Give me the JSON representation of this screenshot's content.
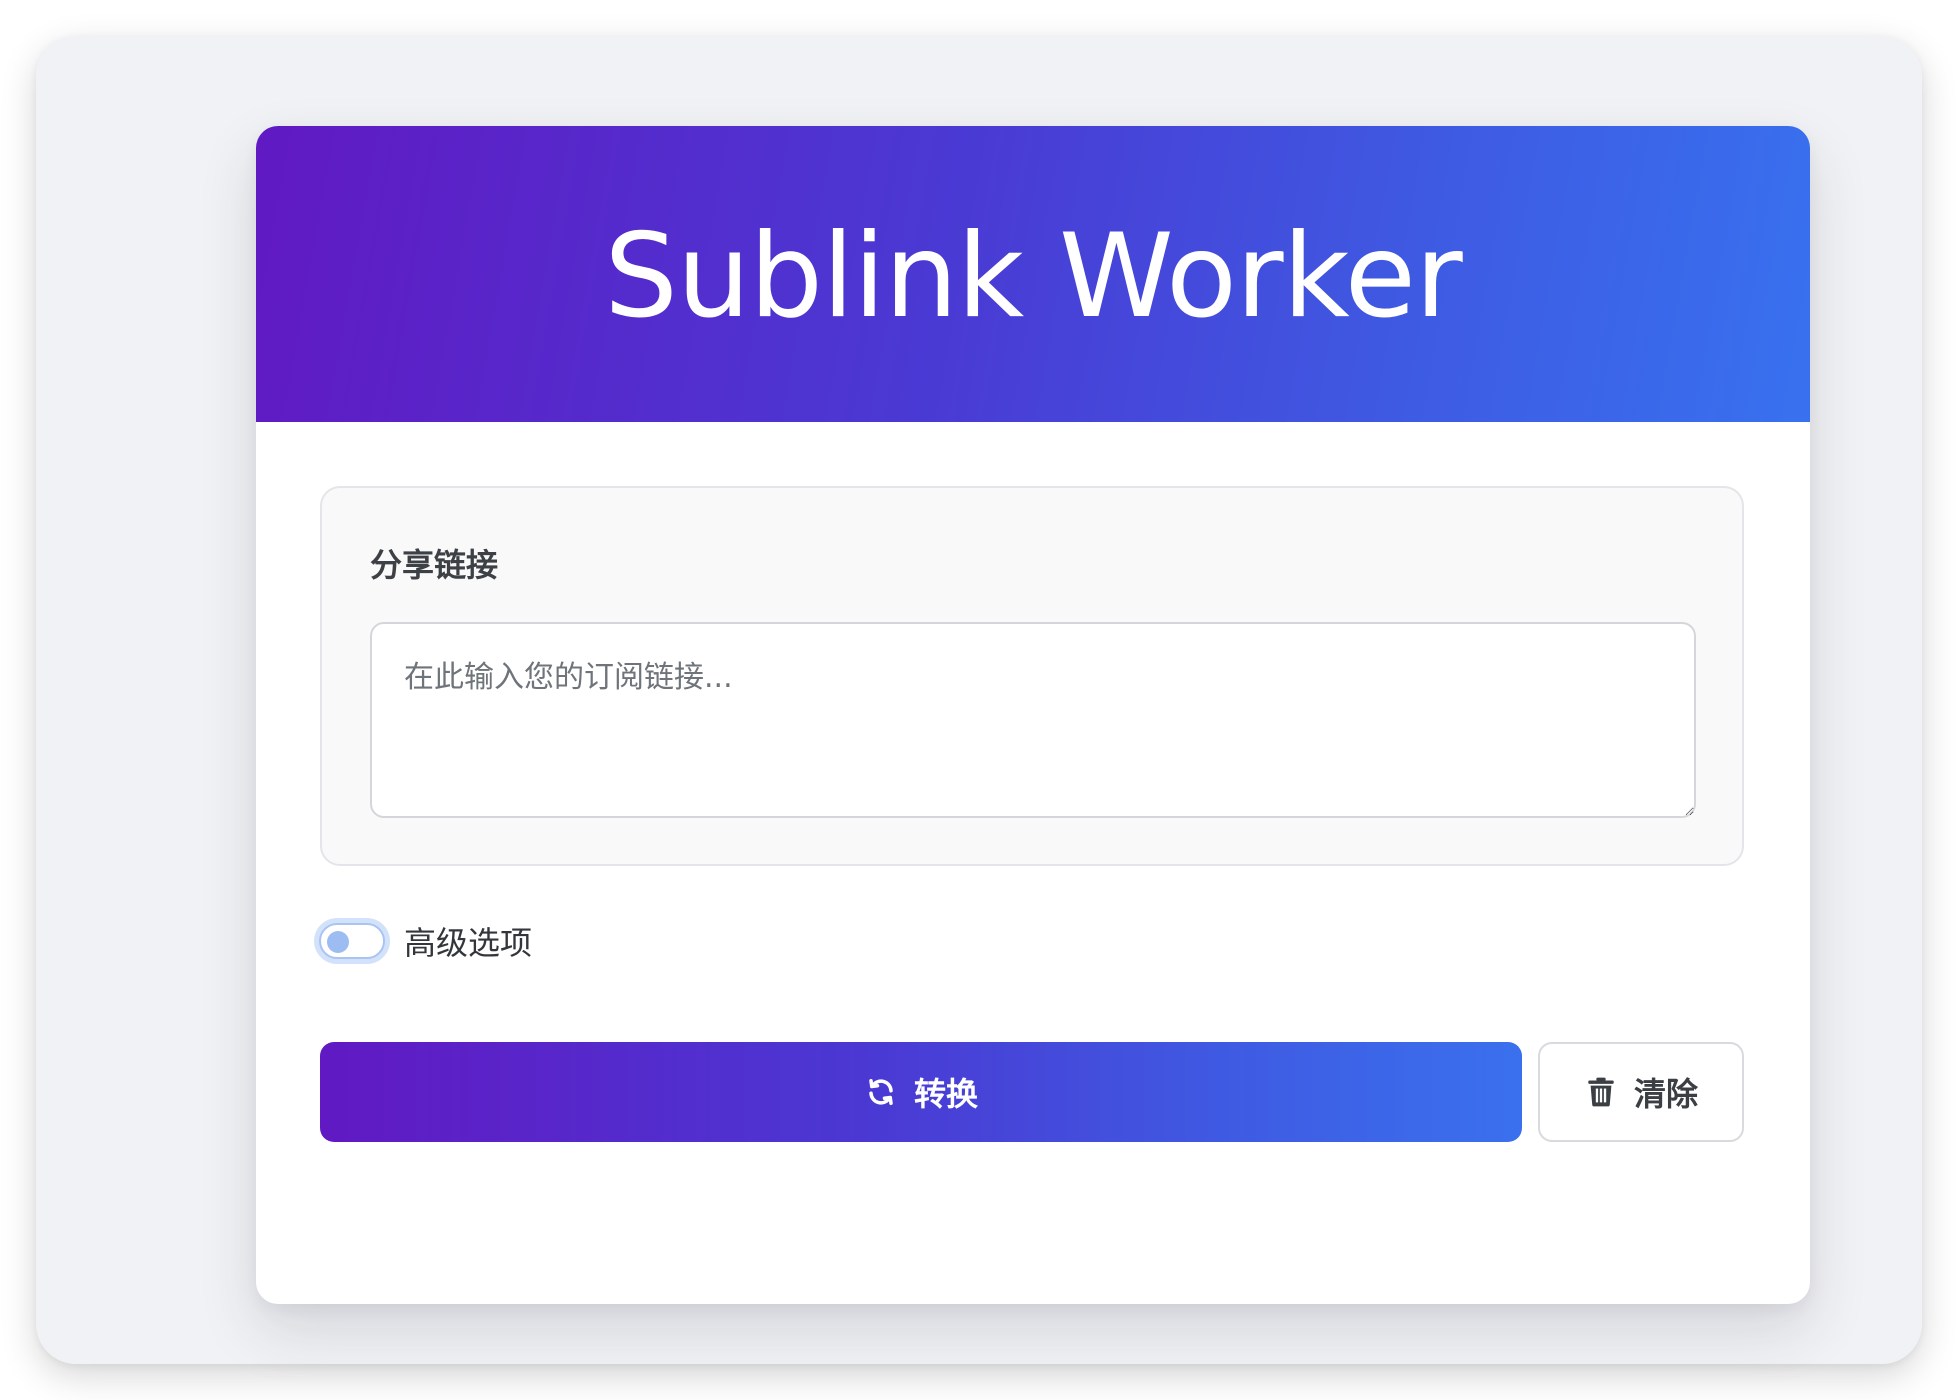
{
  "app": {
    "title": "Sublink Worker"
  },
  "share": {
    "label": "分享链接",
    "textarea_value": "",
    "textarea_placeholder": "在此输入您的订阅链接..."
  },
  "advanced": {
    "label": "高级选项",
    "enabled": false
  },
  "actions": {
    "convert_label": "转换",
    "convert_icon": "sync-icon",
    "clear_label": "清除",
    "clear_icon": "trash-icon"
  },
  "colors": {
    "gradient_start": "#6119c3",
    "gradient_end": "#3871ef",
    "page_background": "#f1f2f5",
    "card_background": "#ffffff"
  }
}
